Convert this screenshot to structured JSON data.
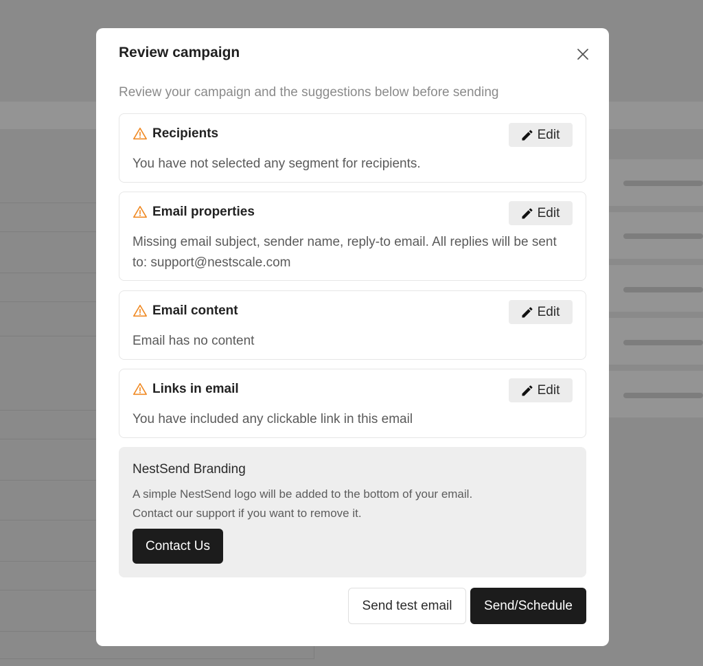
{
  "modal": {
    "title": "Review campaign",
    "subtitle": "Review your campaign and the suggestions below before sending",
    "close_icon": "close-icon"
  },
  "checks": [
    {
      "title": "Recipients",
      "description": "You have not selected any segment for recipients.",
      "edit_label": "Edit",
      "status": "warning"
    },
    {
      "title": "Email properties",
      "description": "Missing email subject, sender name, reply-to email. All replies will be sent to: support@nestscale.com",
      "edit_label": "Edit",
      "status": "warning"
    },
    {
      "title": "Email content",
      "description": "Email has no content",
      "edit_label": "Edit",
      "status": "warning"
    },
    {
      "title": "Links in email",
      "description": "You have included any clickable link in this email",
      "edit_label": "Edit",
      "status": "warning"
    }
  ],
  "branding": {
    "title": "NestSend Branding",
    "line1": "A simple NestSend logo will be added to the bottom of your email.",
    "line2": "Contact our support if you want to remove it.",
    "contact_label": "Contact Us"
  },
  "footer": {
    "test_label": "Send test email",
    "send_label": "Send/Schedule"
  },
  "colors": {
    "warning": "#f08a24",
    "primary_button": "#1c1c1c",
    "overlay": "#8a8a8a"
  }
}
